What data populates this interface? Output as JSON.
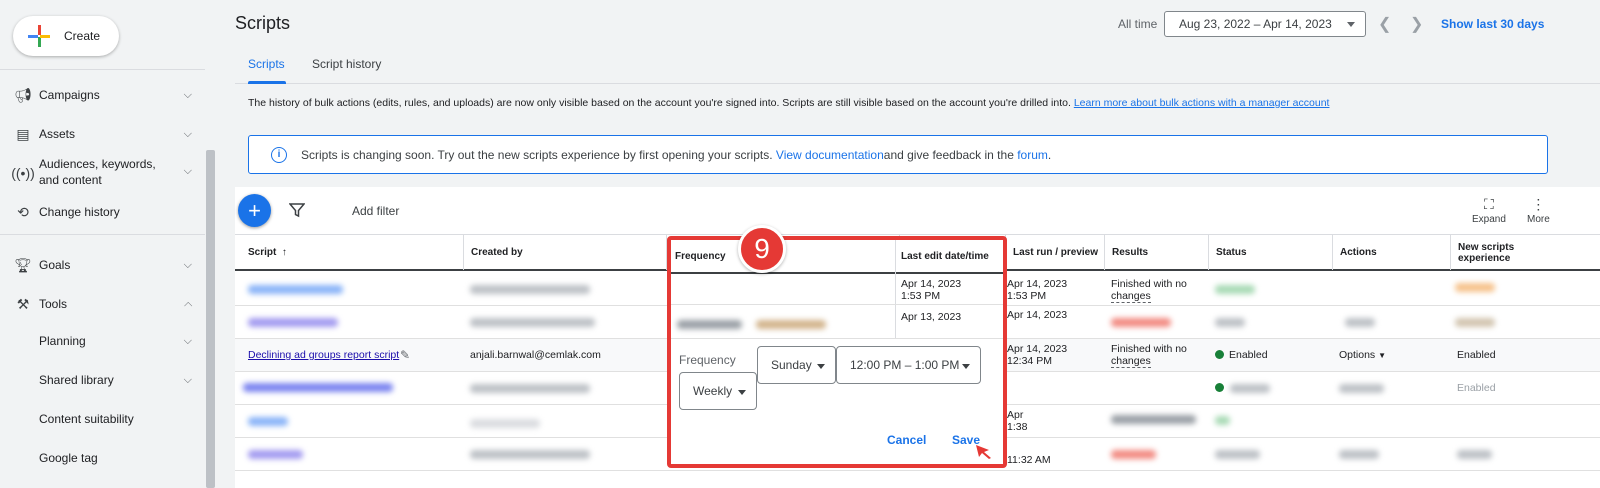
{
  "sidebar": {
    "create_label": "Create",
    "items": [
      {
        "label": "Campaigns",
        "icon": "megaphone-icon"
      },
      {
        "label": "Assets",
        "icon": "assets-icon"
      },
      {
        "label": "Audiences, keywords,",
        "label2": "and content",
        "icon": "broadcast-icon"
      },
      {
        "label": "Change history",
        "icon": "history-icon"
      },
      {
        "label": "Goals",
        "icon": "trophy-icon"
      },
      {
        "label": "Tools",
        "icon": "tools-icon"
      }
    ],
    "sub_items": [
      "Planning",
      "Shared library",
      "Content suitability",
      "Google tag"
    ]
  },
  "header": {
    "title": "Scripts",
    "all_time": "All time",
    "date_range": "Aug 23, 2022 – Apr 14, 2023",
    "show_last": "Show last 30 days"
  },
  "tabs": [
    "Scripts",
    "Script history"
  ],
  "notice": {
    "text": "The history of bulk actions (edits, rules, and uploads) are now only visible based on the account you're signed into. Scripts are still visible based on the account you're drilled into. ",
    "link": "Learn more about bulk actions with a manager account"
  },
  "banner": {
    "text1": "Scripts is changing soon. Try out the new scripts experience by first opening your scripts. ",
    "link1": "View documentation",
    "text2": " and give feedback in the ",
    "link2": "forum",
    "text3": "."
  },
  "toolbar": {
    "add_filter": "Add filter",
    "expand": "Expand",
    "more": "More"
  },
  "table": {
    "headers": {
      "script": "Script",
      "created_by": "Created by",
      "frequency": "Frequency",
      "last_edit": "Last edit date/time",
      "last_run": "Last run / preview",
      "results": "Results",
      "status": "Status",
      "actions": "Actions",
      "new_exp_1": "New scripts",
      "new_exp_2": "experience"
    },
    "row1": {
      "last_edit_1": "Apr 14, 2023",
      "last_edit_2": "1:53 PM",
      "last_run_1": "Apr 14, 2023",
      "last_run_2": "1:53 PM",
      "results_1": "Finished with no",
      "results_2": "changes"
    },
    "row2": {
      "last_edit_1": "Apr 13, 2023",
      "last_run_1": "Apr 14, 2023"
    },
    "row3": {
      "script": "Declining ad groups report script",
      "created_by": "anjali.barnwal@cemlak.com",
      "last_run_1": "Apr 14, 2023",
      "last_run_2": "12:34 PM",
      "results_1": "Finished with no",
      "results_2": "changes",
      "status": "Enabled",
      "actions": "Options",
      "new_exp": "Enabled"
    },
    "row4": {
      "new_exp": "Enabled"
    },
    "row5": {
      "last_run_1": "Apr",
      "last_run_2": "1:38"
    },
    "row6": {
      "last_run_2": "11:32 AM"
    }
  },
  "popup": {
    "step": "9",
    "frequency_label": "Frequency",
    "frequency_value": "Weekly",
    "day_value": "Sunday",
    "time_value": "12:00 PM – 1:00 PM",
    "cancel": "Cancel",
    "save": "Save"
  }
}
